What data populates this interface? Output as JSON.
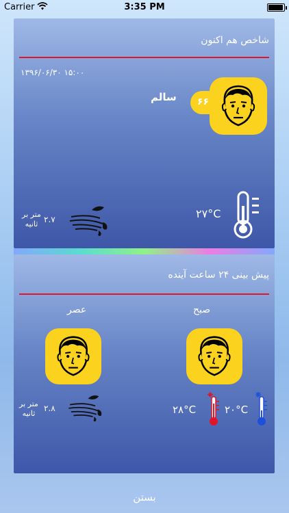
{
  "status_bar": {
    "carrier": "Carrier",
    "time": "3:35 PM",
    "battery_level": 0.9
  },
  "current": {
    "title": "شاخص هم اکنون",
    "datetime": "۱۳۹۶/۰۶/۳۰  ۱۵:۰۰",
    "aqi_value": "۶۶",
    "aqi_status": "سالم",
    "temperature": "۲۷°C",
    "wind_speed": "۲.۷",
    "wind_unit_line1": "متر بر",
    "wind_unit_line2": "ثانیه"
  },
  "forecast": {
    "title": "پیش بینی ۲۴ ساعت آینده",
    "morning_label": "صبح",
    "afternoon_label": "عصر",
    "temp_min": "۲۰°C",
    "temp_max": "۲۸°C",
    "wind_speed": "۲.۸",
    "wind_unit_line1": "متر بر",
    "wind_unit_line2": "ثانیه"
  },
  "close_label": "بستن",
  "colors": {
    "accent_yellow": "#fbd21d",
    "divider_red": "#e0152a",
    "card_top": "#9fb8e6",
    "card_bottom": "#3e57a8"
  },
  "icons": {
    "face": "neutral-face-icon",
    "thermometer": "thermometer-icon",
    "wind": "wind-icon"
  }
}
